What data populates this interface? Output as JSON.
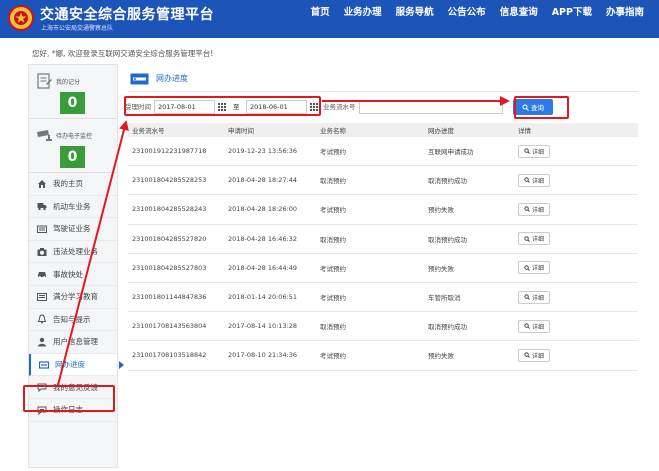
{
  "header": {
    "title": "交通安全综合服务管理平台",
    "subtitle": "上海市公安局交通警察总队",
    "nav": [
      "首页",
      "业务办理",
      "服务导航",
      "公告公布",
      "信息查询",
      "APP下载",
      "办事指南"
    ]
  },
  "welcome": "您好, *娜, 欢迎登录互联网交通安全综合服务管理平台!",
  "sidebar": {
    "cards": [
      {
        "label": "我的记分",
        "value": "0"
      },
      {
        "label": "待办电子监控",
        "value": "0"
      }
    ],
    "items": [
      {
        "label": "我的主页",
        "icon": "home-icon"
      },
      {
        "label": "机动车业务",
        "icon": "truck-icon"
      },
      {
        "label": "驾驶证业务",
        "icon": "id-card-icon"
      },
      {
        "label": "违法处理业务",
        "icon": "camera-icon"
      },
      {
        "label": "事故快处",
        "icon": "car-icon"
      },
      {
        "label": "满分学习教育",
        "icon": "book-icon"
      },
      {
        "label": "告知与提示",
        "icon": "bell-icon"
      },
      {
        "label": "用户信息管理",
        "icon": "user-icon"
      },
      {
        "label": "网办进度",
        "icon": "progress-icon",
        "active": true
      },
      {
        "label": "我的意见反馈",
        "icon": "feedback-icon"
      },
      {
        "label": "操作日志",
        "icon": "log-icon"
      }
    ]
  },
  "panel": {
    "title": "网办进度"
  },
  "filters": {
    "date_label": "受理时间",
    "start_date": "2017-08-01",
    "to_label": "至",
    "end_date": "2018-06-01",
    "serial_label": "业务流水号",
    "serial_value": "",
    "query_label": "查询"
  },
  "table": {
    "columns": [
      "业务流水号",
      "申请时间",
      "业务名称",
      "网办进度",
      "详情"
    ],
    "detail_label": "详细",
    "rows": [
      [
        "231001912231987718",
        "2019-12-23 13:56:36",
        "考试预约",
        "互联网申请成功"
      ],
      [
        "231001804285528253",
        "2018-04-28 18:27:44",
        "取消预约",
        "取消预约成功"
      ],
      [
        "231001804285528243",
        "2018-04-28 18:26:00",
        "考试预约",
        "预约失败"
      ],
      [
        "231001804285527820",
        "2018-04-28 16:46:32",
        "取消预约",
        "取消预约成功"
      ],
      [
        "231001804285527803",
        "2018-04-28 16:44:49",
        "考试预约",
        "预约失败"
      ],
      [
        "231001801144847836",
        "2018-01-14 20:06:51",
        "考试预约",
        "车管所取消"
      ],
      [
        "231001708143563804",
        "2017-08-14 10:13:28",
        "取消预约",
        "取消预约成功"
      ],
      [
        "231001708103518842",
        "2017-08-10 21:34:36",
        "考试预约",
        "预约失败"
      ]
    ]
  },
  "colors": {
    "header_bg": "#1c54b8",
    "accent": "#1c6bd0",
    "score_green": "#3a9b3a",
    "query_blue": "#2c7be5",
    "annotation_red": "#e0191f"
  }
}
